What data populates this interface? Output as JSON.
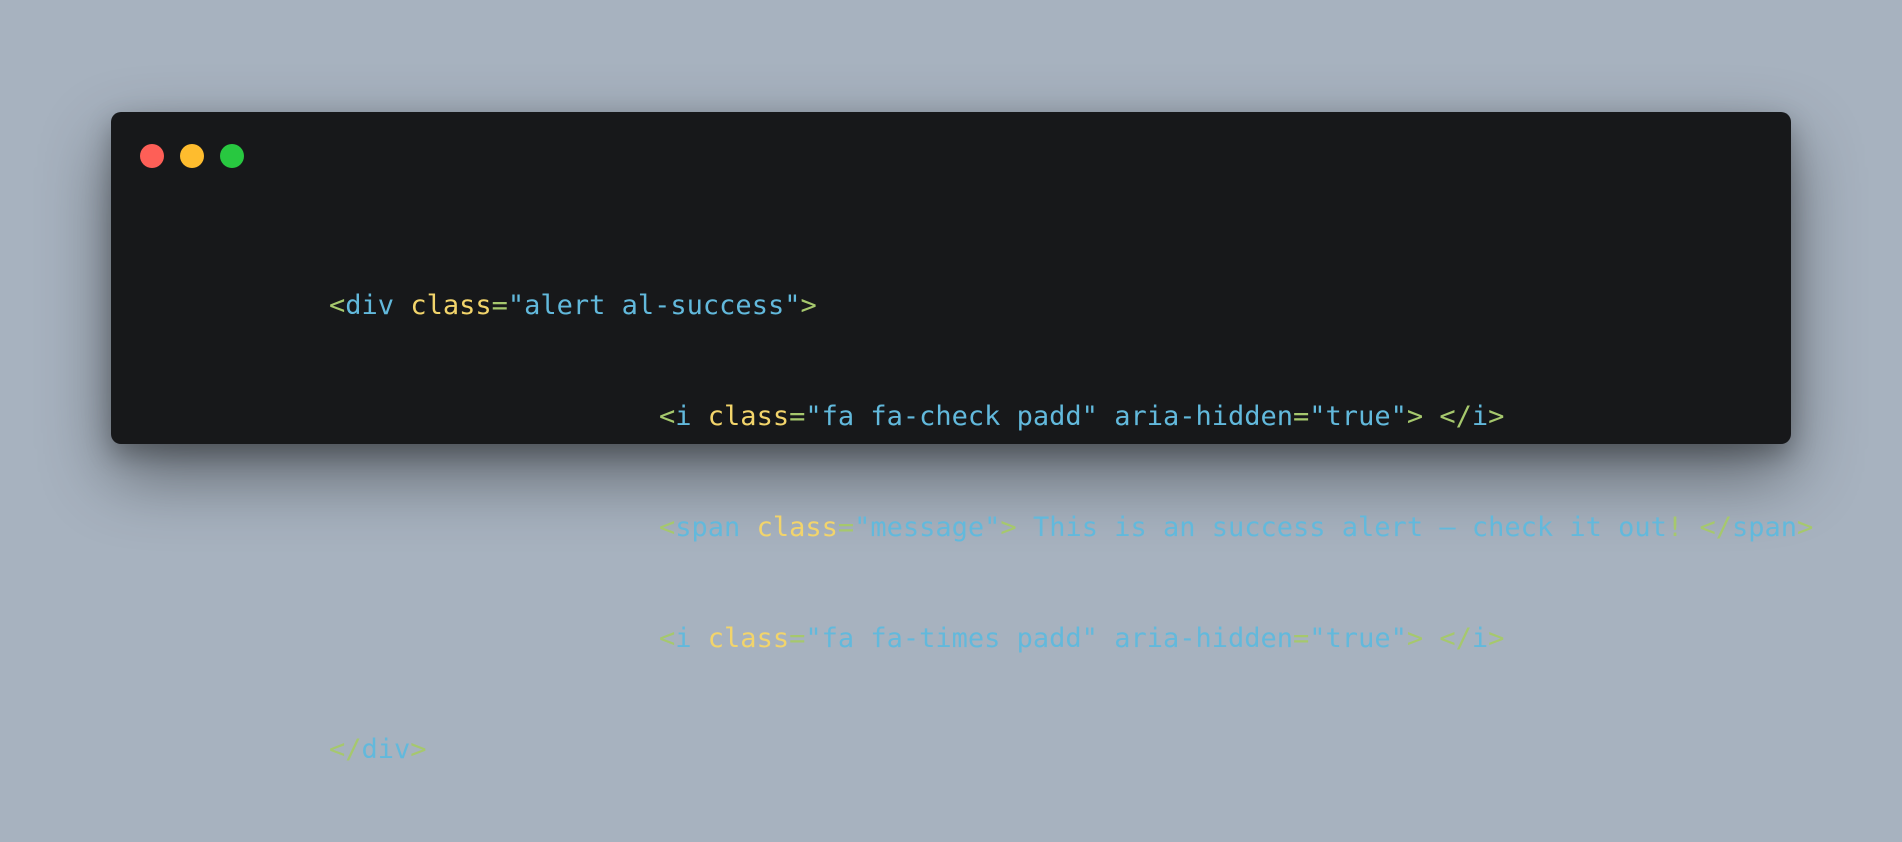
{
  "window_controls": {
    "close_color": "#fe5f57",
    "minimize_color": "#febc2e",
    "maximize_color": "#28c840"
  },
  "code": {
    "lines": [
      {
        "tokens": [
          {
            "type": "punct",
            "text": "<"
          },
          {
            "type": "tag",
            "text": "div"
          },
          {
            "type": "text",
            "text": " "
          },
          {
            "type": "attr",
            "text": "class"
          },
          {
            "type": "punct",
            "text": "="
          },
          {
            "type": "str",
            "text": "\"alert al-success\""
          },
          {
            "type": "punct",
            "text": ">"
          }
        ]
      },
      {
        "tokens": [
          {
            "type": "punct",
            "text": "<"
          },
          {
            "type": "tag",
            "text": "i"
          },
          {
            "type": "text",
            "text": " "
          },
          {
            "type": "attr",
            "text": "class"
          },
          {
            "type": "punct",
            "text": "="
          },
          {
            "type": "str",
            "text": "\"fa fa-check padd\""
          },
          {
            "type": "text",
            "text": " "
          },
          {
            "type": "attr2",
            "text": "aria-hidden"
          },
          {
            "type": "punct",
            "text": "="
          },
          {
            "type": "str",
            "text": "\"true\""
          },
          {
            "type": "punct",
            "text": ">"
          },
          {
            "type": "text",
            "text": " "
          },
          {
            "type": "punct",
            "text": "</"
          },
          {
            "type": "tag",
            "text": "i"
          },
          {
            "type": "punct",
            "text": ">"
          }
        ]
      },
      {
        "tokens": [
          {
            "type": "punct",
            "text": "<"
          },
          {
            "type": "tag",
            "text": "span"
          },
          {
            "type": "text",
            "text": " "
          },
          {
            "type": "attr",
            "text": "class"
          },
          {
            "type": "punct",
            "text": "="
          },
          {
            "type": "str",
            "text": "\"message\""
          },
          {
            "type": "punct",
            "text": ">"
          },
          {
            "type": "text",
            "text": " This is an success alert — check it out"
          },
          {
            "type": "punct",
            "text": "!"
          },
          {
            "type": "text",
            "text": " "
          },
          {
            "type": "punct",
            "text": "</"
          },
          {
            "type": "tag",
            "text": "span"
          },
          {
            "type": "punct",
            "text": ">"
          }
        ]
      },
      {
        "tokens": [
          {
            "type": "punct",
            "text": "<"
          },
          {
            "type": "tag",
            "text": "i"
          },
          {
            "type": "text",
            "text": " "
          },
          {
            "type": "attr",
            "text": "class"
          },
          {
            "type": "punct",
            "text": "="
          },
          {
            "type": "str",
            "text": "\"fa fa-times padd\""
          },
          {
            "type": "text",
            "text": " "
          },
          {
            "type": "attr2",
            "text": "aria-hidden"
          },
          {
            "type": "punct",
            "text": "="
          },
          {
            "type": "str",
            "text": "\"true\""
          },
          {
            "type": "punct",
            "text": ">"
          },
          {
            "type": "text",
            "text": " "
          },
          {
            "type": "punct",
            "text": "</"
          },
          {
            "type": "tag",
            "text": "i"
          },
          {
            "type": "punct",
            "text": ">"
          }
        ]
      },
      {
        "tokens": [
          {
            "type": "punct",
            "text": "</"
          },
          {
            "type": "tag",
            "text": "div"
          },
          {
            "type": "punct",
            "text": ">"
          }
        ]
      }
    ]
  }
}
